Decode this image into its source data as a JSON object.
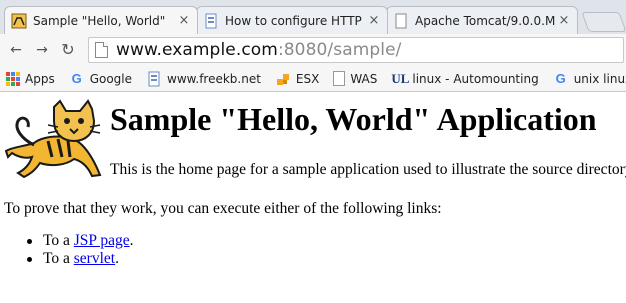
{
  "tabs": [
    {
      "title": "Sample \"Hello, World\"",
      "active": true,
      "close": "×"
    },
    {
      "title": "How to configure HTTP",
      "active": false,
      "close": "×"
    },
    {
      "title": "Apache Tomcat/9.0.0.M",
      "active": false,
      "close": "×"
    }
  ],
  "toolbar": {
    "back": "←",
    "forward": "→",
    "reload": "↻",
    "url_host": "www.example.com",
    "url_rest": ":8080/sample/"
  },
  "bookmarks": [
    {
      "label": "Apps",
      "icon": "apps-grid-icon"
    },
    {
      "label": "Google",
      "icon": "google-icon"
    },
    {
      "label": "www.freekb.net",
      "icon": "freekb-icon"
    },
    {
      "label": "ESX",
      "icon": "esx-icon"
    },
    {
      "label": "WAS",
      "icon": "page-icon"
    },
    {
      "label": "linux - Automounting",
      "icon": "unix-linux-icon"
    },
    {
      "label": "unix linux st",
      "icon": "google-icon"
    }
  ],
  "page": {
    "heading": "Sample \"Hello, World\" Application",
    "intro": "This is the home page for a sample application used to illustrate the source directory",
    "prove": "To prove that they work, you can execute either of the following links:",
    "links": [
      {
        "prefix": "To a ",
        "link": "JSP page",
        "suffix": "."
      },
      {
        "prefix": "To a ",
        "link": "servlet",
        "suffix": "."
      }
    ]
  },
  "colors": {
    "link": "#0000ee",
    "tab_strip": "#dfe3ea",
    "toolbar": "#f6f6f6"
  }
}
